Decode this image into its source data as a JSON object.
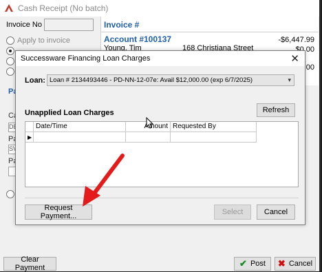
{
  "background_window": {
    "title": "Cash Receipt (No batch)",
    "invoice_no_label": "Invoice No",
    "invoice_no_value": "",
    "radio_apply_invoice": "Apply to invoice",
    "radio_second": "",
    "invoice_header": "Invoice #",
    "account": "Account #100137",
    "customer_name": "Young, Tim",
    "street": "168 Christiana Street",
    "amount_due": "-$6,447.99",
    "amount_2": "$0.00",
    "amount_3": "$0.00",
    "fragments": {
      "pa": "Pa",
      "ca": "Ca",
      "de": "DE",
      "pa2": "Pa",
      "sv": "SV",
      "pa3": "Pa",
      "a": "A"
    },
    "clear_payment": "Clear Payment",
    "post": "Post",
    "cancel": "Cancel"
  },
  "dialog": {
    "title": "Successware Financing Loan Charges",
    "close_glyph": "✕",
    "loan_label": "Loan:",
    "loan_value": "Loan # 2134493446 - PD-NN-12-07e: Avail $12,000.00 (exp 6/7/2025)",
    "section_title": "Unapplied Loan Charges",
    "refresh": "Refresh",
    "columns": [
      "Date/Time",
      "Amount",
      "Requested By"
    ],
    "row_marker": "▶",
    "request_payment": "Request Payment...",
    "select": "Select",
    "cancel": "Cancel"
  },
  "colors": {
    "link_blue": "#1f5fa8",
    "annotation_arrow": "#e31b1b",
    "post_icon": "#1c8a2a",
    "cancel_icon": "#d01010"
  },
  "icons": [
    "app-icon",
    "close-icon",
    "chevron-down-icon",
    "check-icon",
    "x-icon",
    "mouse-cursor-icon",
    "annotation-arrow"
  ]
}
